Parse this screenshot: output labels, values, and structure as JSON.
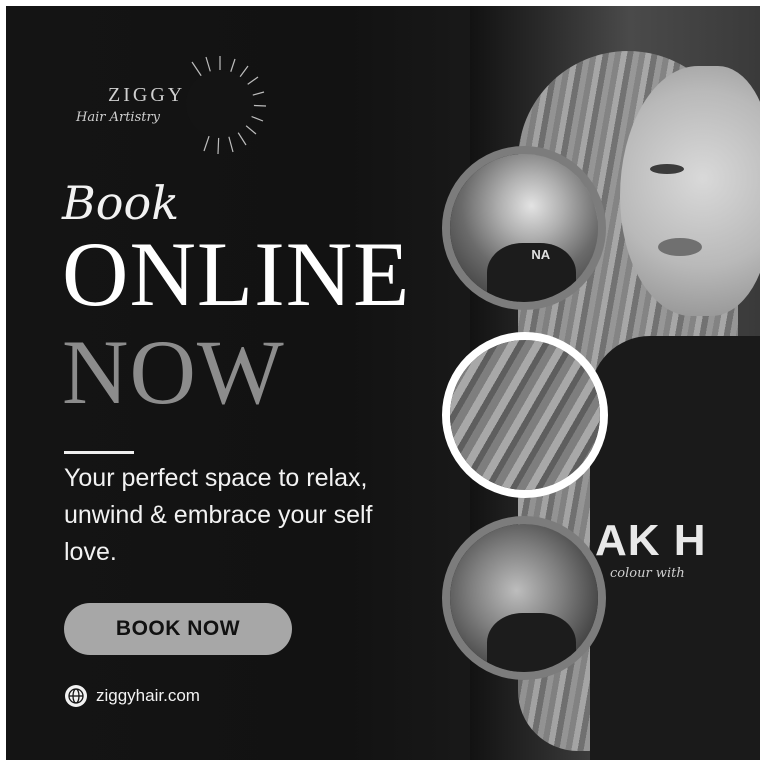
{
  "brand": {
    "name": "ZIGGY",
    "tagline": "Hair Artistry"
  },
  "headline": {
    "book": "Book",
    "online": "ONLINE",
    "now": "NOW"
  },
  "description": "Your perfect space to relax, unwind & embrace your self love.",
  "cta": {
    "label": "BOOK NOW"
  },
  "website": {
    "url": "ziggyhair.com",
    "icon": "globe-icon"
  },
  "photo_text": {
    "shirt_main": "AK H",
    "shirt_sub": "colour with",
    "cape_small": "NA"
  },
  "colors": {
    "background": "#141414",
    "headline_white": "#ffffff",
    "headline_grey": "#8c8c8c",
    "button": "#a7a7a7"
  }
}
